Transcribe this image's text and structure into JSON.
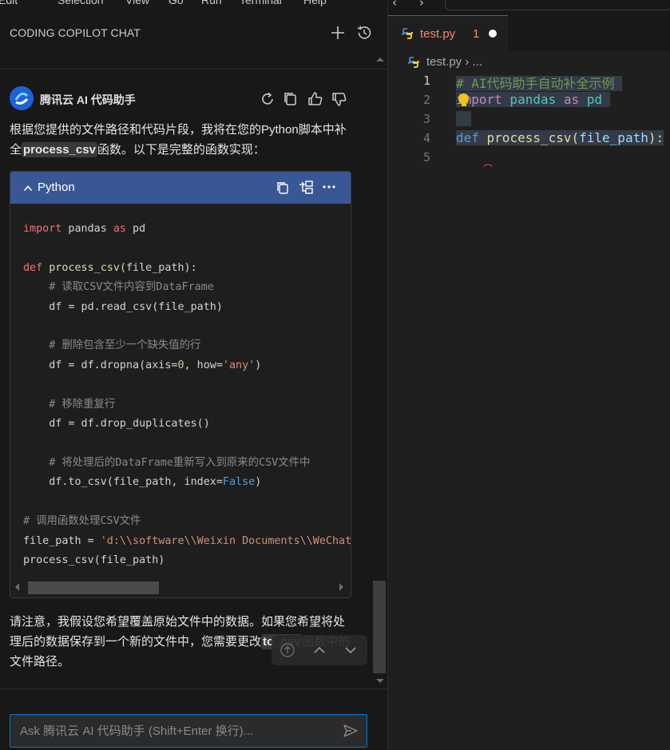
{
  "menubar": {
    "items": [
      "Edit",
      "Selection",
      "View",
      "Go",
      "Run",
      "Terminal",
      "Help"
    ]
  },
  "chat": {
    "title": "CODING COPILOT CHAT",
    "assistant_name": "腾讯云 AI 代码助手",
    "intro_part1": "根据您提供的文件路径和代码片段，我将在您的Python脚本中补全",
    "intro_code": "process_csv",
    "intro_part2": "函数。以下是完整的函数实现：",
    "note_part1": "请注意，我假设您希望覆盖原始文件中的数据。如果您希望将处理后的数据保存到一个新的文件中，您需要更改",
    "note_code": "to_csv",
    "note_part2": "函数中的文件路径。",
    "input_placeholder": "Ask 腾讯云 AI 代码助手 (Shift+Enter 换行)..."
  },
  "code_block": {
    "language": "Python",
    "t": {
      "import": "import",
      "pandas_as": " pandas ",
      "as": "as",
      "pd": " pd",
      "def": "def",
      "fn_name": "process_csv",
      "fn_params": "(file_path):",
      "c1": "    # 读取CSV文件内容到DataFrame",
      "l1": "    df = pd.read_csv(file_path)",
      "c2": "    # 删除包含至少一个缺失值的行",
      "l2a": "    df = df.dropna(axis=",
      "l2num": "0",
      "l2b": ", how=",
      "l2str": "'any'",
      "l2c": ")",
      "c3": "    # 移除重复行",
      "l3": "    df = df.drop_duplicates()",
      "c4": "    # 将处理后的DataFrame重新写入到原来的CSV文件中",
      "l4a": "    df.to_csv(file_path, index=",
      "l4kw": "False",
      "l4b": ")",
      "c5": "# 调用函数处理CSV文件",
      "l5a": "file_path = ",
      "l5str": "'d:\\\\software\\\\Weixin Documents\\\\WeChat",
      "l6": "process_csv(file_path)"
    }
  },
  "editor": {
    "tab_name": "test.py",
    "problem_count": "1",
    "breadcrumb_file": "test.py",
    "breadcrumb_sep": " › ...",
    "line_numbers": [
      "1",
      "2",
      "3",
      "4",
      "5"
    ],
    "code": {
      "line1": "# AI代码助手自动补全示例",
      "l2_import": "import",
      "l2_mod": " pandas ",
      "l2_as": "as",
      "l2_alias": " pd",
      "l4_def": "def",
      "l4_name": " process_csv",
      "l4_open": "(",
      "l4_param": "file_path",
      "l4_close": "):"
    }
  },
  "colors": {
    "accent": "#0078d4",
    "code_header": "#3a5795",
    "error": "#f48771"
  }
}
